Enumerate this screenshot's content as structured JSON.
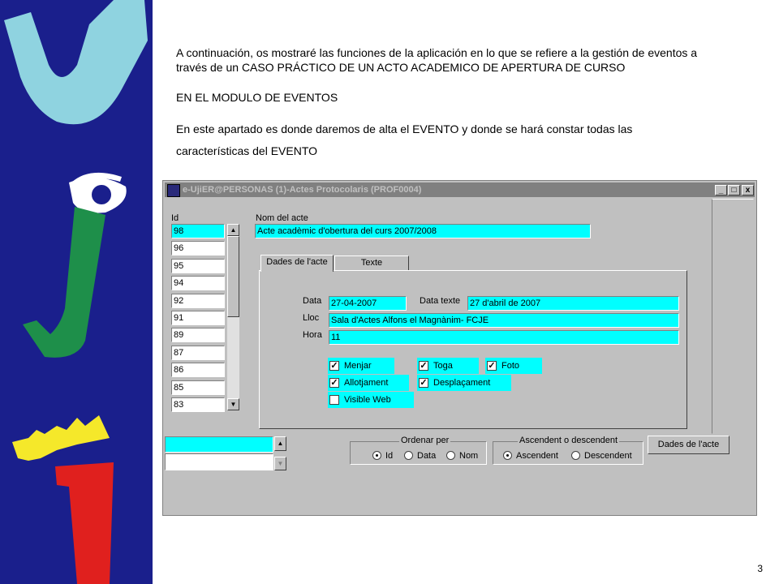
{
  "slide": {
    "line1": "A continuación, os mostraré las funciones de la aplicación en lo que se refiere a la gestión de eventos a",
    "line2": "través de un CASO PRÁCTICO DE UN ACTO ACADEMICO DE APERTURA DE CURSO",
    "line3": "EN EL MODULO DE EVENTOS",
    "line4": "En este apartado es donde daremos de alta el EVENTO  y donde se hará constar todas las",
    "line5": "características del EVENTO",
    "page_number": "3"
  },
  "colors": {
    "sidebar": "#1a1f8c",
    "field_highlight": "#00ffff",
    "window_face": "#c0c0c0"
  },
  "window": {
    "title": "e-UjiER@PERSONAS (1)-Actes Protocolaris (PROF0004)",
    "minimize": "_",
    "maximize": "□",
    "close": "x"
  },
  "list": {
    "header": "Id",
    "ids": [
      "98",
      "96",
      "95",
      "94",
      "92",
      "91",
      "89",
      "87",
      "86",
      "85",
      "83"
    ]
  },
  "form": {
    "nom_label": "Nom del acte",
    "nom_value": "Acte acadèmic d'obertura del curs 2007/2008",
    "tabs": [
      "Dades de l'acte",
      "Texte"
    ],
    "data_label": "Data",
    "data_value": "27-04-2007",
    "data_texte_label": "Data texte",
    "data_texte_value": "27 d'abril de 2007",
    "lloc_label": "Lloc",
    "lloc_value": "Sala d'Actes Alfons el Magnànim- FCJE",
    "hora_label": "Hora",
    "hora_value": "11",
    "checkboxes": [
      {
        "label": "Menjar",
        "checked": true
      },
      {
        "label": "Toga",
        "checked": true
      },
      {
        "label": "Foto",
        "checked": true
      },
      {
        "label": "Allotjament",
        "checked": true
      },
      {
        "label": "Desplaçament",
        "checked": true
      },
      {
        "label": "Visible Web",
        "checked": false
      }
    ]
  },
  "bottom": {
    "ordenar_title": "Ordenar per",
    "ordenar_options": [
      "Id",
      "Data",
      "Nom"
    ],
    "ordenar_selected": "Id",
    "asc_title": "Ascendent o descendent",
    "asc_options": [
      "Ascendent",
      "Descendent"
    ],
    "asc_selected": "Ascendent",
    "button_label": "Dades de l'acte"
  }
}
